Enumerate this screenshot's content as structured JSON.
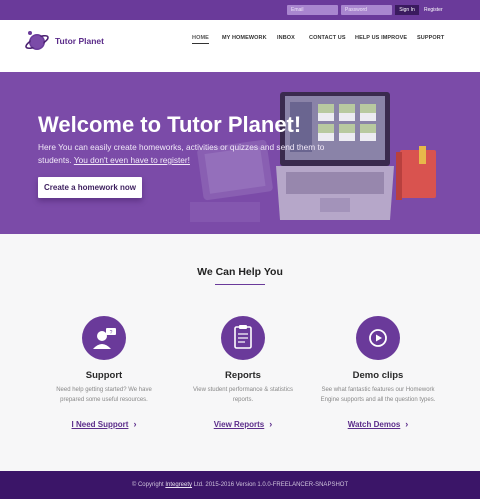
{
  "topbar": {
    "email_placeholder": "Email",
    "password_placeholder": "Password",
    "signin_label": "Sign In",
    "register_label": "Register"
  },
  "header": {
    "brand": "Tutor Planet",
    "nav": [
      {
        "label": "HOME",
        "active": true
      },
      {
        "label": "MY HOMEWORK"
      },
      {
        "label": "INBOX"
      },
      {
        "label": "CONTACT US"
      },
      {
        "label": "HELP US IMPROVE"
      },
      {
        "label": "SUPPORT"
      }
    ]
  },
  "hero": {
    "title": "Welcome to Tutor Planet!",
    "subtitle_part1": "Here You can easily create homeworks, activities or quizzes and send them to students.",
    "subtitle_link": "You don't even have to register!",
    "cta_label": "Create a homework now"
  },
  "section": {
    "title": "We Can Help You"
  },
  "features": [
    {
      "title": "Support",
      "description": "Need help getting started? We have prepared some useful resources.",
      "link": "I Need Support",
      "icon": "support-agent-icon"
    },
    {
      "title": "Reports",
      "description": "View student performance & statistics reports.",
      "link": "View Reports",
      "icon": "clipboard-icon"
    },
    {
      "title": "Demo clips",
      "description": "See what fantastic features our Homework Engine supports and all the question types.",
      "link": "Watch Demos",
      "icon": "play-icon"
    }
  ],
  "footer": {
    "prefix": "© Copyright",
    "company": "Integreety",
    "suffix": "Ltd. 2015-2016 Version 1.0.0-FREELANCER-SNAPSHOT"
  },
  "colors": {
    "brand": "#6a3a9a",
    "hero_bg": "#7b4ba8",
    "footer_bg": "#3b1568"
  }
}
